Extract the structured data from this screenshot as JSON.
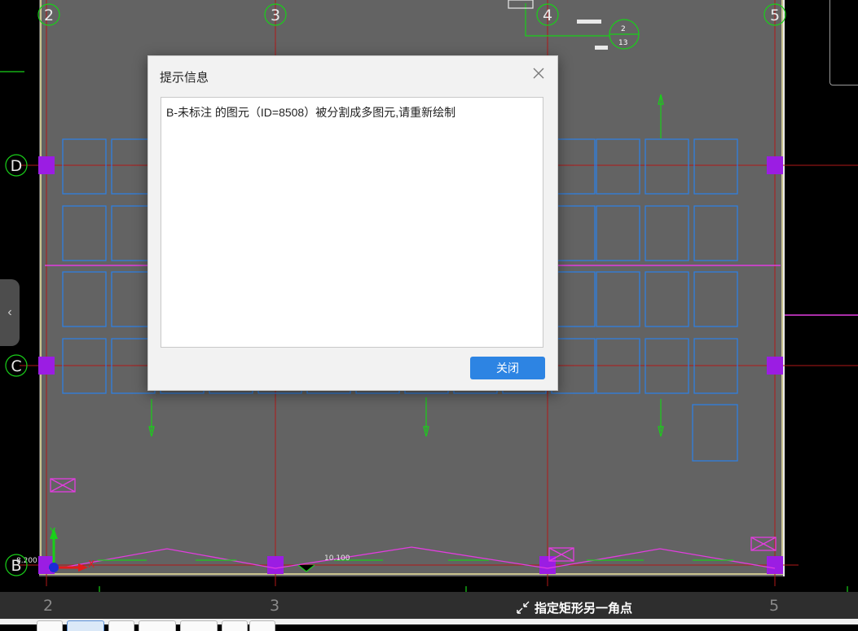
{
  "grid": {
    "columns": [
      "2",
      "3",
      "4",
      "5"
    ],
    "rows": [
      "D",
      "C",
      "B"
    ]
  },
  "drawing": {
    "elevation_label": "8.200",
    "dim_label": "10.100",
    "symbol_top": "2",
    "symbol_bottom": "13",
    "ucs_x": "X",
    "ucs_y": "Y"
  },
  "colors": {
    "background": "#000000",
    "slab": "#636363",
    "grid_line": "#b01818",
    "column": "#9b1de3",
    "opening": "#2f7fe0",
    "magenta": "#e23ddf",
    "green": "#19d019",
    "boundary": "#c9c38f",
    "dialog_button": "#2d84e3"
  },
  "command_prompt": {
    "icon": "corner-arrows-icon",
    "text": "指定矩形另一角点"
  },
  "collapse_handle": {
    "icon": "chevron-left-icon",
    "glyph": "‹"
  },
  "dialog": {
    "title": "提示信息",
    "message": "B-未标注 的图元（ID=8508）被分割成多图元,请重新绘制",
    "close_button": "关闭"
  }
}
